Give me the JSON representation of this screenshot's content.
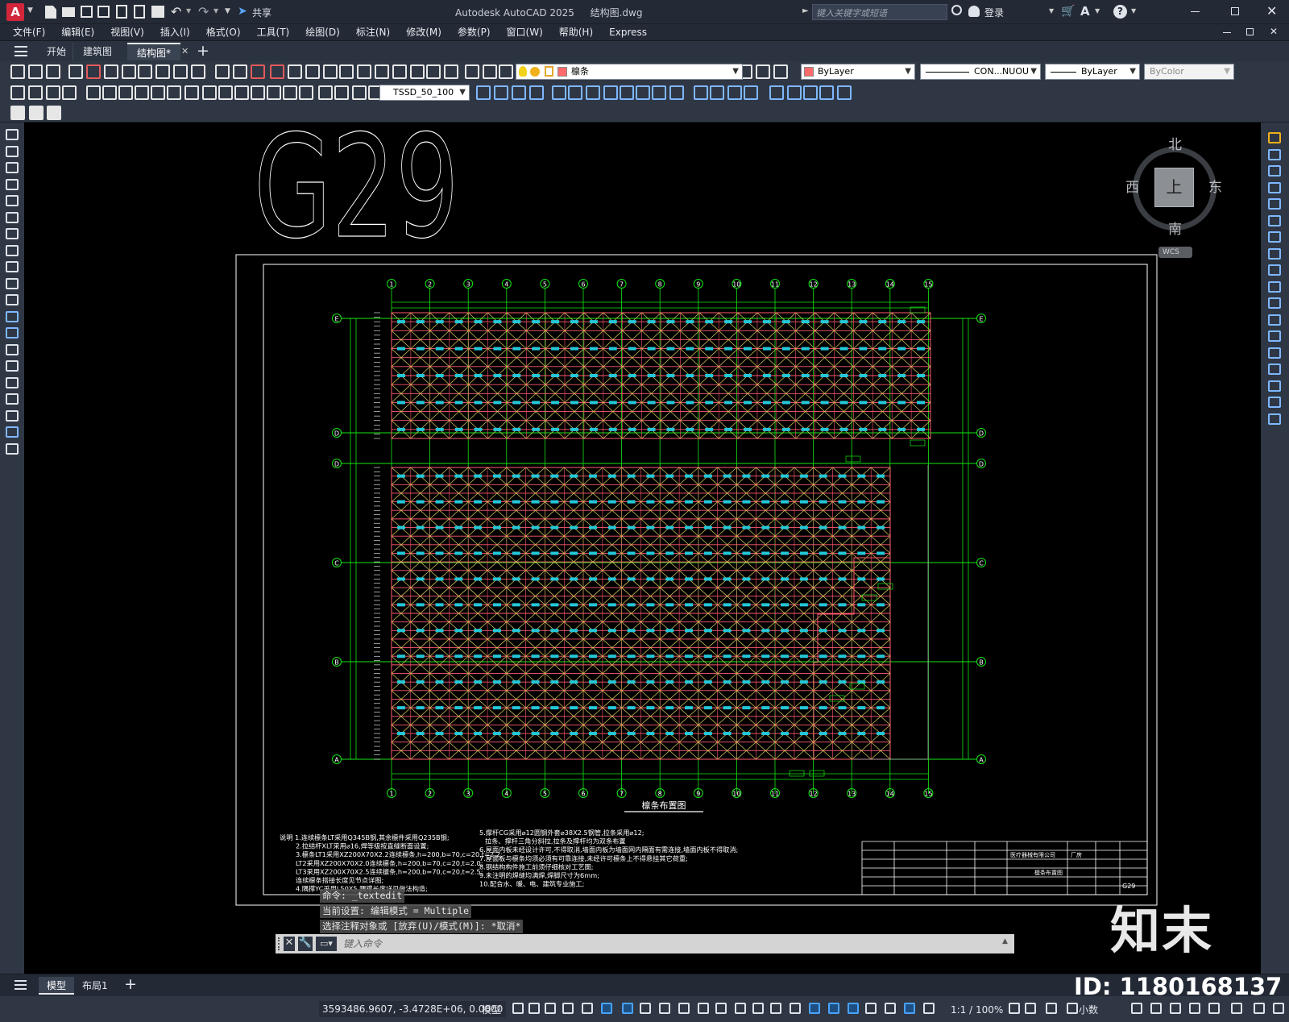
{
  "window": {
    "app_title": "Autodesk AutoCAD 2025",
    "file_name": "结构图.dwg",
    "share_label": "共享",
    "search_placeholder": "键入关键字或短语",
    "login_label": "登录",
    "help_icon": "?"
  },
  "menu": [
    "文件(F)",
    "编辑(E)",
    "视图(V)",
    "插入(I)",
    "格式(O)",
    "工具(T)",
    "绘图(D)",
    "标注(N)",
    "修改(M)",
    "参数(P)",
    "窗口(W)",
    "帮助(H)",
    "Express"
  ],
  "tabs": [
    {
      "label": "开始"
    },
    {
      "label": "建筑图"
    },
    {
      "label": "结构图*"
    }
  ],
  "toolbar": {
    "layer_name": "檩条",
    "color": "ByLayer",
    "linetype": "CON...NUOU",
    "lineweight": "ByLayer",
    "plotstyle": "ByColor",
    "dimstyle": "TSSD_50_100"
  },
  "viewcube": {
    "north": "北",
    "south": "南",
    "east": "东",
    "west": "西",
    "top": "上",
    "wcs": "WCS"
  },
  "drawing": {
    "big_label": "G29",
    "plan_title": "檩条布置图",
    "col_axes": [
      "1",
      "2",
      "3",
      "4",
      "5",
      "6",
      "7",
      "8",
      "9",
      "10",
      "11",
      "12",
      "13",
      "14",
      "15"
    ],
    "row_axes_upper": [
      "E",
      "D"
    ],
    "row_axes_lower": [
      "D",
      "C",
      "B",
      "A"
    ],
    "notes_left": [
      "说明  1.连续檩条LT采用Q345B钢,其余檩件采用Q235B钢;",
      "2.拉结杆XLT采用⌀16,焊等级按直缝断面设置;",
      "3.檩条LT1采用XZ200X70X2.2连续檩条,h=200,b=70,c=20,t=2.2;",
      "LT2采用XZ200X70X2.0连续檩条,h=200,b=70,c=20,t=2.0;",
      "LT3采用XZ200X70X2.5连续檩条,h=200,b=70,c=20,t=2.5;",
      "连续檩条搭接长度见节点详图;",
      "4.隅撑YC采用L50X5,隅撑长度详见做法构造;"
    ],
    "notes_right": [
      "5.撑杆CG采用⌀12圆钢外套⌀38X2.5钢管,拉条采用⌀12;",
      "拉条、撑杆三角分斜拉,拉条及撑杆均为双条布置",
      "6.屋面内板未经设计许可,不得取消,墙面内板为墙面网内隔面有需连接,墙面内板不得取消;",
      "7.屋面板与檩条均须必须有可靠连接,未经许可檩条上不得悬挂其它荷重;",
      "8.钢结构构件施工前须仔细核对工艺图;",
      "9.未注明的焊缝均满焊,焊脚尺寸为6mm;",
      "10.配合水、暖、电、建筑专业施工;"
    ],
    "titleblock": {
      "company": "医疗器械有限公司",
      "project": "厂房",
      "sheet": "檩条布置图",
      "num": "G29"
    }
  },
  "command": {
    "history": [
      "命令: _textedit",
      "当前设置: 编辑模式 = Multiple",
      "选择注释对象或 [放弃(U)/模式(M)]: *取消*"
    ],
    "placeholder": "键入命令"
  },
  "layouts": [
    {
      "label": "模型"
    },
    {
      "label": "布局1"
    }
  ],
  "status": {
    "coords": "3593486.9607, -3.4728E+06, 0.0000",
    "model": "模型",
    "scale": "1:1 / 100%",
    "units": "小数"
  },
  "watermark": {
    "brand": "知末",
    "id": "ID: 1180168137"
  },
  "colors": {
    "green": "#14e614",
    "red": "#ff5a6e",
    "cyan": "#22c8d8",
    "yellow": "#e0d060",
    "white": "#ffffff",
    "panel": "#2f3745"
  }
}
